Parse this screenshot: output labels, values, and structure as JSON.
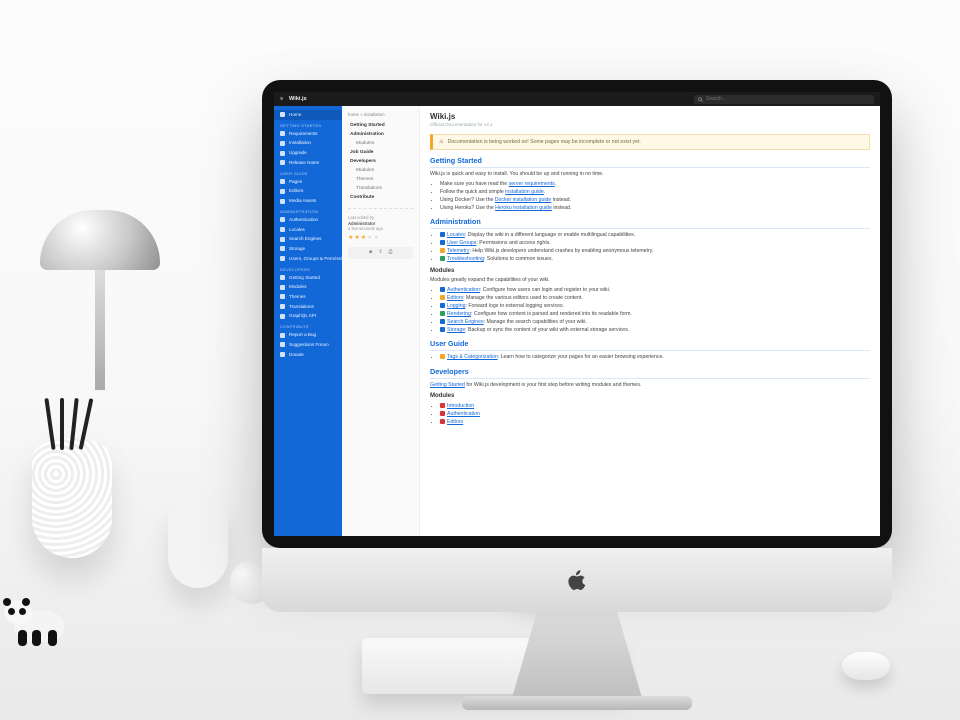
{
  "app": {
    "title": "Wiki.js"
  },
  "search": {
    "placeholder": "Search..."
  },
  "sidebar": {
    "home": "Home",
    "sections": [
      {
        "label": "Getting Started",
        "items": [
          "Requirements",
          "Installation",
          "Upgrade",
          "Release Notes"
        ]
      },
      {
        "label": "User Guide",
        "items": [
          "Pages",
          "Editors",
          "Media Assets"
        ]
      },
      {
        "label": "Administration",
        "items": [
          "Authentication",
          "Locales",
          "Search Engines",
          "Storage",
          "Users, Groups & Permissions"
        ]
      },
      {
        "label": "Developers",
        "items": [
          "Getting Started",
          "Modules",
          "Themes",
          "Translations",
          "GraphQL API"
        ]
      },
      {
        "label": "Contribute",
        "items": [
          "Report a Bug",
          "Suggestions Forum",
          "Donate"
        ]
      }
    ]
  },
  "toc": {
    "crumb": "home » installation",
    "items": [
      {
        "label": "Getting Started",
        "bold": true
      },
      {
        "label": "Administration",
        "bold": true
      },
      {
        "label": "Modules",
        "indent": true
      },
      {
        "label": "Job Guide",
        "bold": true
      },
      {
        "label": "Developers",
        "bold": true
      },
      {
        "label": "Modules",
        "indent": true
      },
      {
        "label": "Themes",
        "indent": true
      },
      {
        "label": "Translations",
        "indent": true
      },
      {
        "label": "Contribute",
        "bold": true
      }
    ],
    "meta_label": "Last edited by",
    "meta_author": "Administrator",
    "meta_date": "a few seconds ago",
    "rating": 3
  },
  "page": {
    "title": "Wiki.js",
    "subtitle": "Official Documentation for v2.x",
    "callout": "Documentation is being worked on! Some pages may be incomplete or not exist yet.",
    "intro": "Wiki.js is quick and easy to install. You should be up and running in no time.",
    "getting_started_heading": "Getting Started",
    "gs_items": [
      {
        "pre": "Make sure you have read the ",
        "link": "server requirements",
        "post": "."
      },
      {
        "pre": "Follow the quick and simple ",
        "link": "installation guide",
        "post": "."
      },
      {
        "pre": "Using Docker? Use the ",
        "link": "Docker installation guide",
        "post": " instead."
      },
      {
        "pre": "Using Heroku? Use the ",
        "link": "Heroku installation guide",
        "post": " instead."
      }
    ],
    "admin_heading": "Administration",
    "admin_items": [
      {
        "link": "Locales",
        "desc": ": Display the wiki in a different language or enable multilingual capabilities."
      },
      {
        "link": "User Groups",
        "desc": ": Permissions and access rights."
      },
      {
        "link": "Telemetry",
        "desc": ": Help Wiki.js developers understand crashes by enabling anonymous telemetry."
      },
      {
        "link": "Troubleshooting",
        "desc": ": Solutions to common issues."
      }
    ],
    "modules_heading": "Modules",
    "modules_intro": "Modules greatly expand the capabilities of your wiki.",
    "module_items": [
      {
        "link": "Authentication",
        "desc": ": Configure how users can login and register to your wiki."
      },
      {
        "link": "Editors",
        "desc": ": Manage the various editors used to create content."
      },
      {
        "link": "Logging",
        "desc": ": Forward logs to external logging services."
      },
      {
        "link": "Rendering",
        "desc": ": Configure how content is parsed and rendered into its readable form."
      },
      {
        "link": "Search Engines",
        "desc": ": Manage the search capabilities of your wiki."
      },
      {
        "link": "Storage",
        "desc": ": Backup or sync the content of your wiki with external storage services."
      }
    ],
    "userguide_heading": "User Guide",
    "ug_items": [
      {
        "link": "Tags & Categorization",
        "desc": ": Learn how to categorize your pages for an easier browsing experience."
      }
    ],
    "dev_heading": "Developers",
    "dev_intro_link": "Getting Started",
    "dev_intro_rest": " for Wiki.js development is your first step before writing modules and themes.",
    "dev_modules_heading": "Modules",
    "dev_module_items": [
      "Introduction",
      "Authentication",
      "Editors"
    ]
  }
}
